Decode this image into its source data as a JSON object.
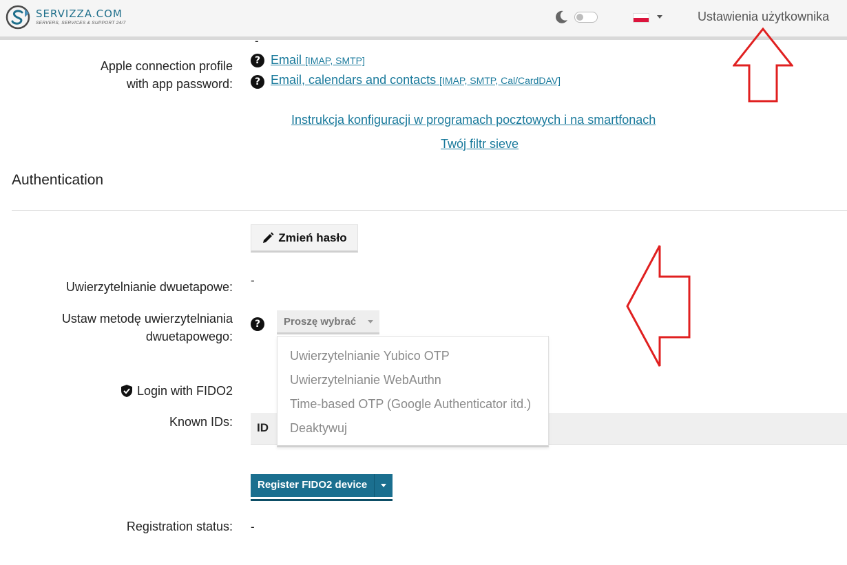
{
  "navbar": {
    "brand_name": "SERVIZZA.COM",
    "brand_tagline": "SERVERS, SERVICES & SUPPORT 24/7",
    "user_settings": "Ustawienia użytkownika",
    "language_flag": "flag-pl-icon",
    "theme_toggle_on": false
  },
  "apple_profile": {
    "label_line1": "Apple connection profile",
    "label_line2": "with app password:",
    "links": [
      {
        "text": "Email",
        "detail": "[IMAP, SMTP]"
      },
      {
        "text": "Email, calendars and contacts",
        "detail": "[IMAP, SMTP, Cal/CardDAV]"
      }
    ],
    "top_dash": "-"
  },
  "config_link": "Instrukcja konfiguracji w programach pocztowych i na smartfonach",
  "sieve_link": "Twój filtr sieve",
  "auth": {
    "title": "Authentication",
    "change_password": "Zmień hasło",
    "two_step_label": "Uwierzytelnianie dwuetapowe:",
    "two_step_value": "-",
    "method_label_line1": "Ustaw metodę uwierzytelniania",
    "method_label_line2": "dwuetapowego:",
    "select_placeholder": "Proszę wybrać",
    "options": [
      "Uwierzytelnianie Yubico OTP",
      "Uwierzytelnianie WebAuthn",
      "Time-based OTP (Google Authenticator itd.)",
      "Deaktywuj"
    ],
    "fido_title": "Login with FIDO2",
    "known_ids_label": "Known IDs:",
    "table_col_id": "ID",
    "register_button": "Register FIDO2 device",
    "registration_status_label": "Registration status:",
    "registration_status_value": "-"
  },
  "colors": {
    "accent": "#1b6f8f",
    "link": "#1a7a9c",
    "annotation_arrow": "#e02020"
  }
}
